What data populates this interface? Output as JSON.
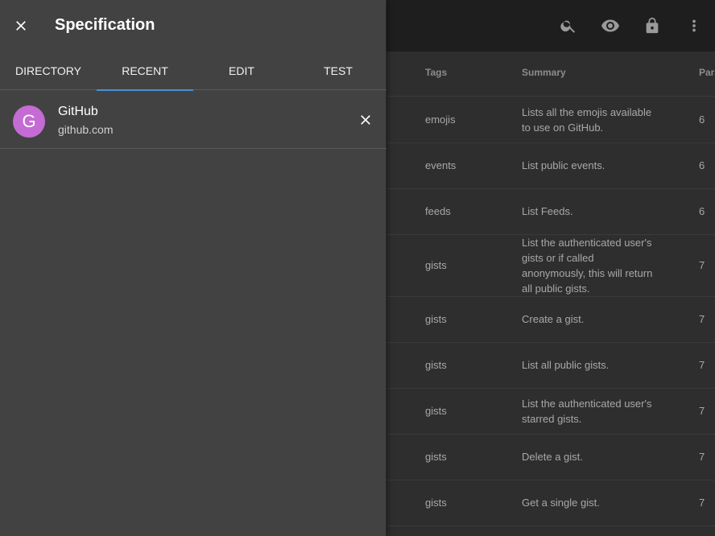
{
  "drawer": {
    "title": "Specification",
    "tabs": [
      {
        "label": "DIRECTORY"
      },
      {
        "label": "RECENT",
        "active": true
      },
      {
        "label": "EDIT"
      },
      {
        "label": "TEST"
      }
    ],
    "recent": [
      {
        "avatar_letter": "G",
        "name": "GitHub",
        "url": "github.com",
        "avatar_color": "#c46bd4"
      }
    ]
  },
  "toolbar": {
    "icons": [
      "search-icon",
      "eye-icon",
      "lock-icon",
      "more-vert-icon"
    ]
  },
  "table": {
    "headers": {
      "tags": "Tags",
      "summary": "Summary",
      "params": "Para"
    },
    "rows": [
      {
        "tag": "emojis",
        "summary": "Lists all the emojis available to use on GitHub.",
        "params": "6"
      },
      {
        "tag": "events",
        "summary": "List public events.",
        "params": "6"
      },
      {
        "tag": "feeds",
        "summary": "List Feeds.",
        "params": "6"
      },
      {
        "tag": "gists",
        "summary": "List the authenticated user's gists or if called anonymously, this will return all public gists.",
        "params": "7"
      },
      {
        "tag": "gists",
        "summary": "Create a gist.",
        "params": "7"
      },
      {
        "tag": "gists",
        "summary": "List all public gists.",
        "params": "7"
      },
      {
        "tag": "gists",
        "summary": "List the authenticated user's starred gists.",
        "params": "7"
      },
      {
        "tag": "gists",
        "summary": "Delete a gist.",
        "params": "7"
      },
      {
        "tag": "gists",
        "summary": "Get a single gist.",
        "params": "7"
      }
    ]
  },
  "colors": {
    "accent": "#4a90d9",
    "drawer_bg": "#424242",
    "avatar": "#c46bd4"
  }
}
